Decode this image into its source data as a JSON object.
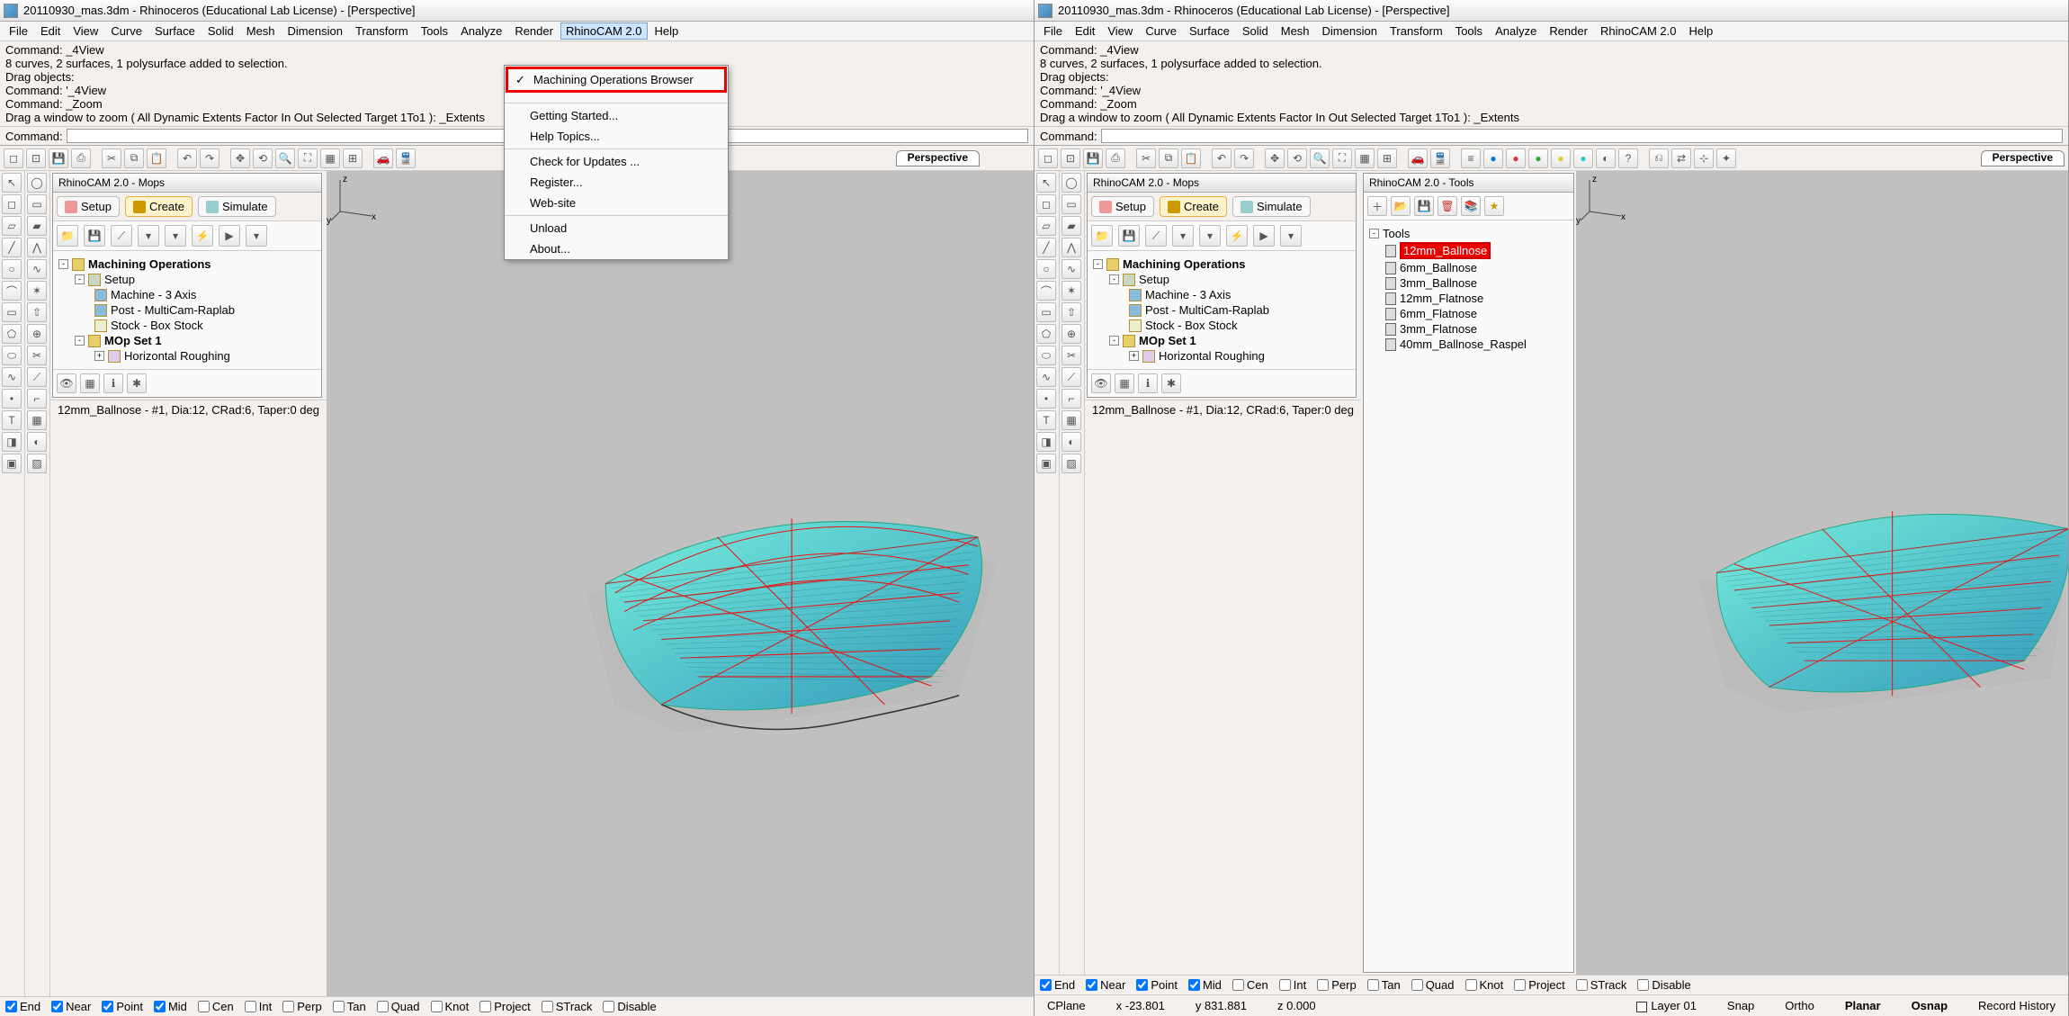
{
  "title": "20110930_mas.3dm - Rhinoceros (Educational Lab License) - [Perspective]",
  "menus": [
    "File",
    "Edit",
    "View",
    "Curve",
    "Surface",
    "Solid",
    "Mesh",
    "Dimension",
    "Transform",
    "Tools",
    "Analyze",
    "Render",
    "RhinoCAM 2.0",
    "Help"
  ],
  "cmd_history": [
    "Command: _4View",
    "8 curves, 2 surfaces, 1 polysurface added to selection.",
    "Drag objects:",
    "Command: '_4View",
    "Command: _Zoom",
    "Drag a window to zoom ( All  Dynamic  Extents  Factor  In  Out  Selected  Target  1To1 ): _Extents"
  ],
  "cmd_label": "Command:",
  "persp": "Perspective",
  "mops_title": "RhinoCAM 2.0 - Mops",
  "tools_title": "RhinoCAM 2.0 - Tools",
  "mops_tabs": [
    {
      "l": "Setup"
    },
    {
      "l": "Create"
    },
    {
      "l": "Simulate"
    }
  ],
  "tree_root": "Machining Operations",
  "tree": {
    "setup": "Setup",
    "machine": "Machine - 3 Axis",
    "post": "Post - MultiCam-Raplab",
    "stock": "Stock - Box Stock",
    "mopset": "MOp Set 1",
    "hrough": "Horizontal Roughing"
  },
  "tool_status": "12mm_Ballnose - #1, Dia:12, CRad:6, Taper:0 deg",
  "osnap": [
    "End",
    "Near",
    "Point",
    "Mid",
    "Cen",
    "Int",
    "Perp",
    "Tan",
    "Quad",
    "Knot",
    "Project",
    "STrack",
    "Disable"
  ],
  "osnap_checked": [
    "End",
    "Near",
    "Point",
    "Mid"
  ],
  "dropdown": {
    "mob": "Machining Operations Browser",
    "gs": "Getting Started...",
    "ht": "Help Topics...",
    "cfu": "Check for Updates ...",
    "reg": "Register...",
    "ws": "Web-site",
    "ul": "Unload",
    "ab": "About..."
  },
  "tools_tree_root": "Tools",
  "tools_list": [
    "12mm_Ballnose",
    "6mm_Ballnose",
    "3mm_Ballnose",
    "12mm_Flatnose",
    "6mm_Flatnose",
    "3mm_Flatnose",
    "40mm_Ballnose_Raspel"
  ],
  "status": {
    "cplane": "CPlane",
    "x": "x -23.801",
    "y": "y 831.881",
    "z": "z 0.000",
    "layer": "Layer 01",
    "snap": "Snap",
    "ortho": "Ortho",
    "planar": "Planar",
    "osnap": "Osnap",
    "rec": "Record History"
  }
}
